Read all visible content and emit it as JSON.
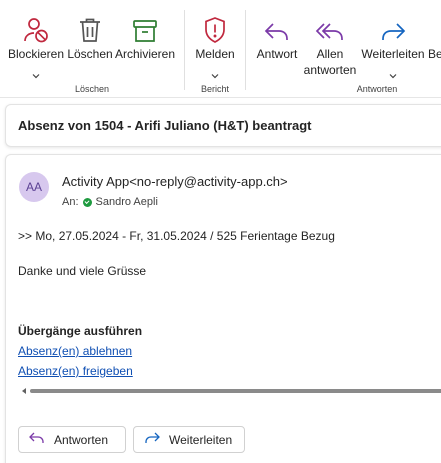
{
  "ribbon": {
    "block_label": "Blockieren",
    "delete_label": "Löschen",
    "archive_label": "Archivieren",
    "report_label": "Melden",
    "reply_label": "Antwort",
    "reply_all_label_line1": "Allen",
    "reply_all_label_line2": "antworten",
    "forward_label": "Weiterleiten",
    "overflow_label": "Be",
    "groups": {
      "delete": "Löschen",
      "report": "Bericht",
      "respond": "Antworten"
    },
    "colors": {
      "block": "#c0283e",
      "delete": "#555555",
      "archive": "#2e7d32",
      "report": "#c0283e",
      "reply": "#7b3aa8",
      "forward": "#1565c0"
    },
    "icons": [
      "block-icon",
      "trash-icon",
      "archive-icon",
      "shield-icon",
      "reply-icon",
      "reply-all-icon",
      "forward-icon",
      "chevron-down-icon"
    ]
  },
  "email": {
    "subject": "Absenz von 1504 - Arifi Juliano (H&T) beantragt",
    "avatar_initials": "AA",
    "sender": "Activity App<no-reply@activity-app.ch>",
    "to_label": "An:",
    "recipient": "Sandro Aepli",
    "body_line1": ">> Mo, 27.05.2024 - Fr, 31.05.2024 / 525 Ferientage Bezug",
    "body_line2": "Danke und viele Grüsse",
    "section_heading": "Übergänge ausführen",
    "link_reject": "Absenz(en) ablehnen",
    "link_approve": "Absenz(en) freigeben",
    "reply_button": "Antworten",
    "forward_button": "Weiterleiten"
  }
}
